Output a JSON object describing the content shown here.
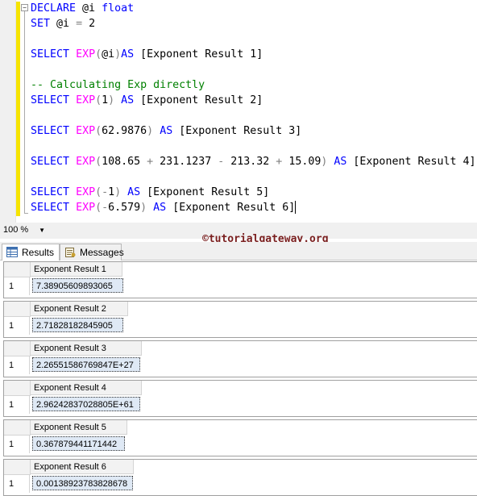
{
  "editor": {
    "lines": [
      [
        {
          "t": "DECLARE",
          "c": "kw"
        },
        {
          "t": " @i ",
          "c": ""
        },
        {
          "t": "float",
          "c": "kw"
        }
      ],
      [
        {
          "t": "SET",
          "c": "kw"
        },
        {
          "t": " @i ",
          "c": ""
        },
        {
          "t": "=",
          "c": "op"
        },
        {
          "t": " 2",
          "c": ""
        }
      ],
      [],
      [
        {
          "t": "SELECT",
          "c": "kw"
        },
        {
          "t": " ",
          "c": ""
        },
        {
          "t": "EXP",
          "c": "fn"
        },
        {
          "t": "(",
          "c": "op"
        },
        {
          "t": "@i",
          "c": ""
        },
        {
          "t": ")",
          "c": "op"
        },
        {
          "t": "AS",
          "c": "kw"
        },
        {
          "t": " [Exponent Result 1]",
          "c": ""
        }
      ],
      [],
      [
        {
          "t": "-- Calculating Exp directly",
          "c": "cm"
        }
      ],
      [
        {
          "t": "SELECT",
          "c": "kw"
        },
        {
          "t": " ",
          "c": ""
        },
        {
          "t": "EXP",
          "c": "fn"
        },
        {
          "t": "(",
          "c": "op"
        },
        {
          "t": "1",
          "c": ""
        },
        {
          "t": ")",
          "c": "op"
        },
        {
          "t": " ",
          "c": ""
        },
        {
          "t": "AS",
          "c": "kw"
        },
        {
          "t": " [Exponent Result 2]",
          "c": ""
        }
      ],
      [],
      [
        {
          "t": "SELECT",
          "c": "kw"
        },
        {
          "t": " ",
          "c": ""
        },
        {
          "t": "EXP",
          "c": "fn"
        },
        {
          "t": "(",
          "c": "op"
        },
        {
          "t": "62.9876",
          "c": ""
        },
        {
          "t": ")",
          "c": "op"
        },
        {
          "t": " ",
          "c": ""
        },
        {
          "t": "AS",
          "c": "kw"
        },
        {
          "t": " [Exponent Result 3]",
          "c": ""
        }
      ],
      [],
      [
        {
          "t": "SELECT",
          "c": "kw"
        },
        {
          "t": " ",
          "c": ""
        },
        {
          "t": "EXP",
          "c": "fn"
        },
        {
          "t": "(",
          "c": "op"
        },
        {
          "t": "108.65 ",
          "c": ""
        },
        {
          "t": "+",
          "c": "op"
        },
        {
          "t": " 231.1237 ",
          "c": ""
        },
        {
          "t": "-",
          "c": "op"
        },
        {
          "t": " 213.32 ",
          "c": ""
        },
        {
          "t": "+",
          "c": "op"
        },
        {
          "t": " 15.09",
          "c": ""
        },
        {
          "t": ")",
          "c": "op"
        },
        {
          "t": " ",
          "c": ""
        },
        {
          "t": "AS",
          "c": "kw"
        },
        {
          "t": " [Exponent Result 4]",
          "c": ""
        }
      ],
      [],
      [
        {
          "t": "SELECT",
          "c": "kw"
        },
        {
          "t": " ",
          "c": ""
        },
        {
          "t": "EXP",
          "c": "fn"
        },
        {
          "t": "(-",
          "c": "op"
        },
        {
          "t": "1",
          "c": ""
        },
        {
          "t": ")",
          "c": "op"
        },
        {
          "t": " ",
          "c": ""
        },
        {
          "t": "AS",
          "c": "kw"
        },
        {
          "t": " [Exponent Result 5]",
          "c": ""
        }
      ],
      [
        {
          "t": "SELECT",
          "c": "kw"
        },
        {
          "t": " ",
          "c": ""
        },
        {
          "t": "EXP",
          "c": "fn"
        },
        {
          "t": "(-",
          "c": "op"
        },
        {
          "t": "6.579",
          "c": ""
        },
        {
          "t": ")",
          "c": "op"
        },
        {
          "t": " ",
          "c": ""
        },
        {
          "t": "AS",
          "c": "kw"
        },
        {
          "t": " [Exponent Result 6]",
          "c": ""
        }
      ]
    ]
  },
  "zoom": {
    "value": "100 %"
  },
  "watermark": "©tutorialgateway.org",
  "tabs": {
    "results": "Results",
    "messages": "Messages"
  },
  "results": [
    {
      "header": "Exponent Result 1",
      "row": "1",
      "value": "7.38905609893065"
    },
    {
      "header": "Exponent Result 2",
      "row": "1",
      "value": "2.71828182845905"
    },
    {
      "header": "Exponent Result 3",
      "row": "1",
      "value": "2.26551586769847E+27"
    },
    {
      "header": "Exponent Result 4",
      "row": "1",
      "value": "2.96242837028805E+61"
    },
    {
      "header": "Exponent Result 5",
      "row": "1",
      "value": "0.367879441171442"
    },
    {
      "header": "Exponent Result 6",
      "row": "1",
      "value": "0.00138923783828678"
    }
  ],
  "colors": {
    "keyword": "#0000ff",
    "function": "#ff00ff",
    "operator": "#808080",
    "comment": "#008000",
    "change_bar": "#f6e400"
  },
  "icons": {
    "results_tab": "grid-icon",
    "messages_tab": "messages-icon",
    "zoom": "chevron-down-icon"
  }
}
